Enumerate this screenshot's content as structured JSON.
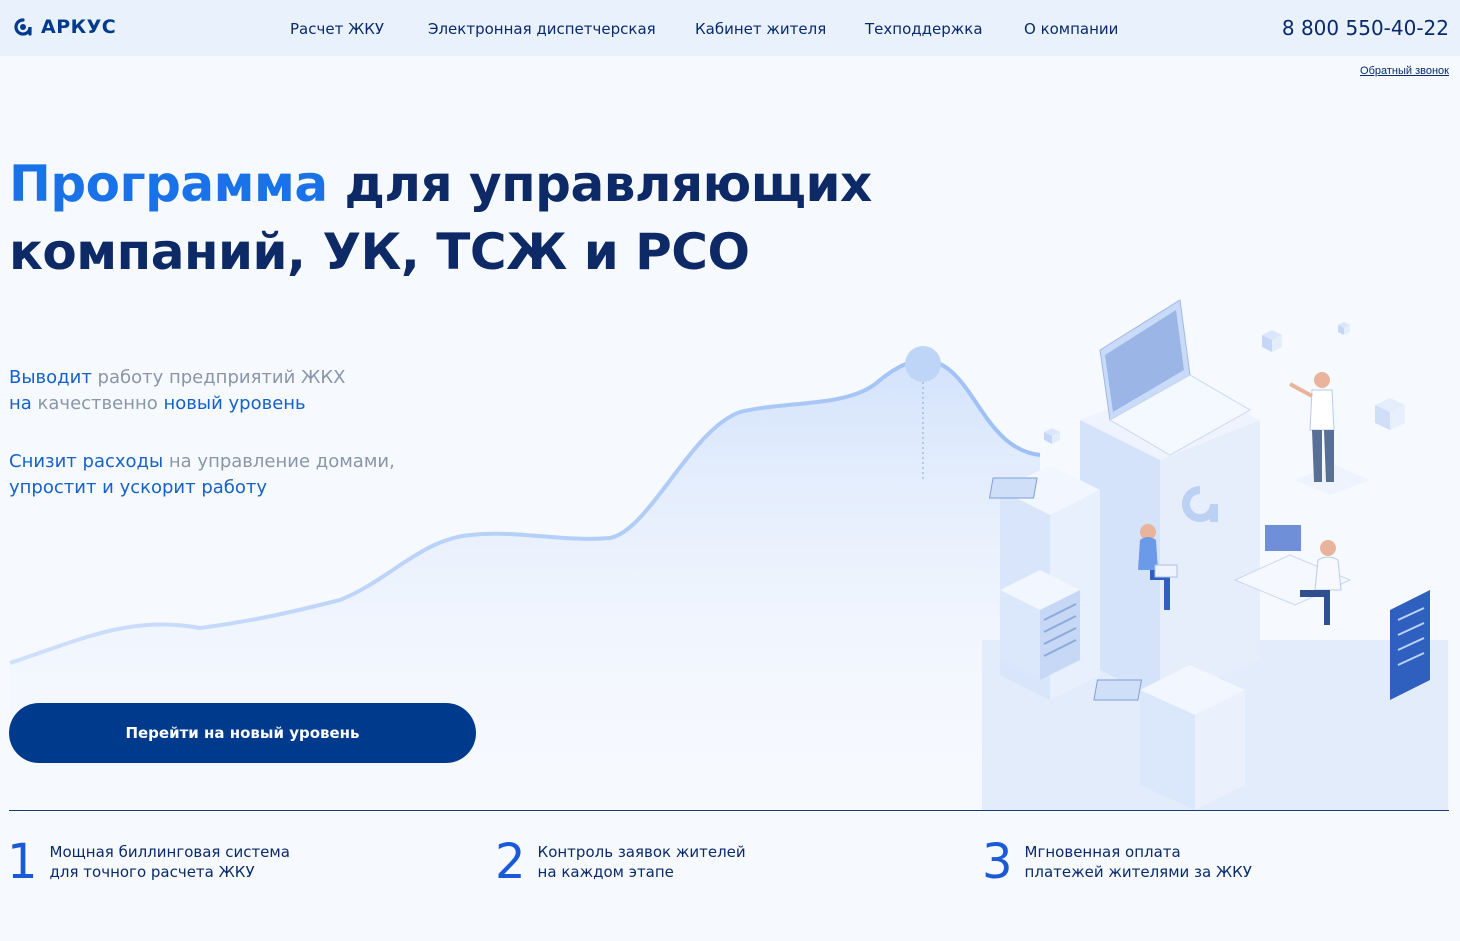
{
  "brand": {
    "name": "АРКУС",
    "color": "#003a8c",
    "accent": "#1a72e8"
  },
  "nav": [
    {
      "label": "Расчет ЖКУ"
    },
    {
      "label": "Электронная диспетчерская"
    },
    {
      "label": "Кабинет жителя"
    },
    {
      "label": "Техподдержка"
    },
    {
      "label": "О компании"
    }
  ],
  "phone": "8 800 550-40-22",
  "callback": "Обратный звонок",
  "hero": {
    "title_accent": "Программа",
    "title_rest_line1": " для управляющих",
    "title_line2": "компаний, УК, ТСЖ и РСО",
    "point1": {
      "hl1": "Выводит",
      "t1": " работу предприятий ЖКХ",
      "hl2": "на",
      "t2": " качественно ",
      "hl3": "новый уровень"
    },
    "point2": {
      "hl1": "Снизит расходы",
      "t1": " на управление домами,",
      "hl2": "упростит и ускорит работу"
    },
    "cta": "Перейти на новый уровень"
  },
  "features": [
    {
      "num": "1",
      "line1": "Мощная биллинговая система",
      "line2": "для точного расчета ЖКУ"
    },
    {
      "num": "2",
      "line1": "Контроль заявок жителей",
      "line2": "на каждом этапе"
    },
    {
      "num": "3",
      "line1": "Мгновенная оплата",
      "line2": "платежей жителями за ЖКУ"
    }
  ],
  "icons": [
    "arkus-logo-icon",
    "growth-curve-illustration",
    "isometric-office-illustration"
  ]
}
